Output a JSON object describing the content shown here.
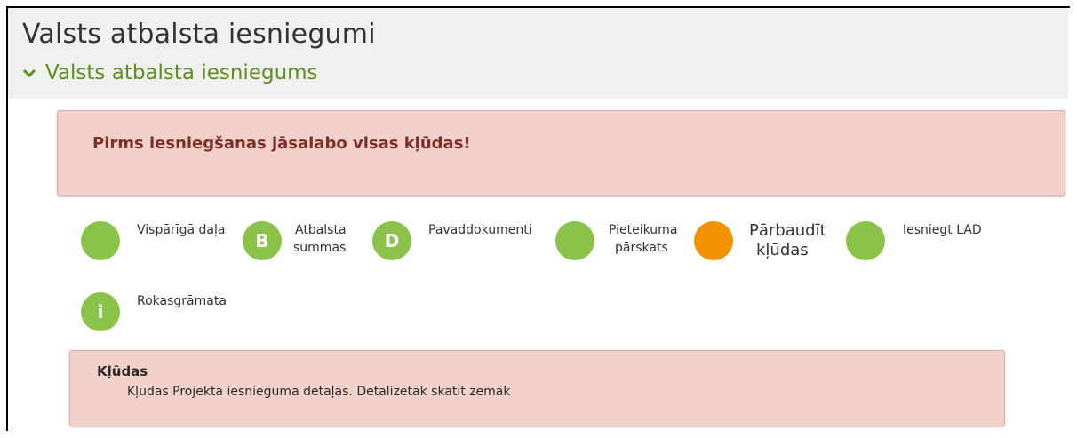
{
  "header": {
    "title": "Valsts atbalsta iesniegumi",
    "section_label": "Valsts atbalsta iesniegums"
  },
  "alert": {
    "message": "Pirms iesniegšanas jāsalabo visas kļūdas!"
  },
  "steps": [
    {
      "label_line1": "Vispārīgā daļa",
      "label_line2": "",
      "letter": "",
      "color": "#8bc34a"
    },
    {
      "label_line1": "Atbalsta",
      "label_line2": "summas",
      "letter": "B",
      "color": "#8bc34a"
    },
    {
      "label_line1": "Pavaddokumenti",
      "label_line2": "",
      "letter": "D",
      "color": "#8bc34a"
    },
    {
      "label_line1": "Pieteikuma",
      "label_line2": "pārskats",
      "letter": "",
      "color": "#8bc34a"
    },
    {
      "label_line1": "Pārbaudīt",
      "label_line2": "kļūdas",
      "letter": "",
      "color": "#f39200"
    },
    {
      "label_line1": "Iesniegt LAD",
      "label_line2": "",
      "letter": "",
      "color": "#8bc34a"
    },
    {
      "label_line1": "Rokasgrāmata",
      "label_line2": "",
      "letter": "i",
      "color": "#8bc34a"
    }
  ],
  "errors": {
    "title": "Kļūdas",
    "text": "Kļūdas Projekta iesnieguma detaļās. Detalizētāk skatīt zemāk"
  },
  "colors": {
    "accent_green": "#8bc34a",
    "section_green": "#5c8f1c",
    "warning_orange": "#f39200",
    "alert_bg": "#f2d0cb",
    "alert_text": "#7a2e24"
  }
}
